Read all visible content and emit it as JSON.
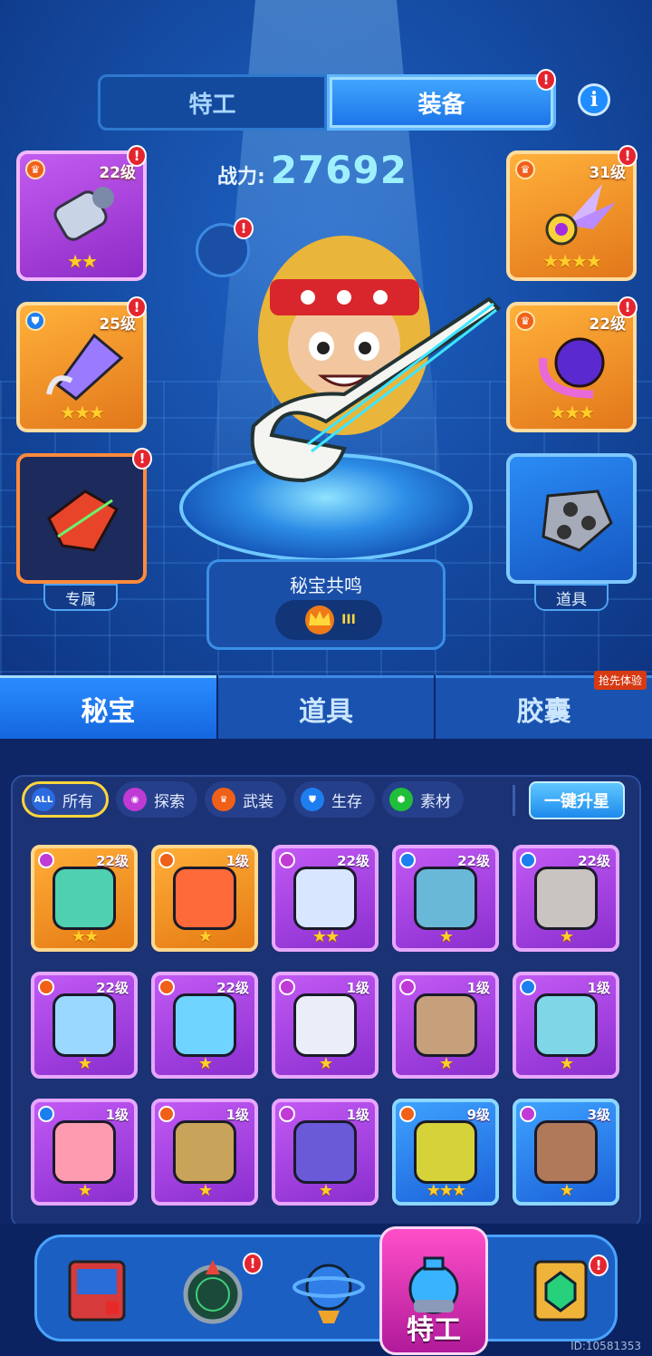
{
  "header": {
    "tabs": [
      {
        "label": "特工",
        "active": false
      },
      {
        "label": "装备",
        "active": true,
        "badge": "!"
      }
    ],
    "info_icon": "i"
  },
  "power": {
    "label": "战力:",
    "value": "27692"
  },
  "equipment": {
    "left": [
      {
        "level": "22级",
        "stars": "★★",
        "rarity": "purple",
        "badge": "!"
      },
      {
        "level": "25级",
        "stars": "★★★",
        "rarity": "orange",
        "badge": "!"
      },
      {
        "label": "专属",
        "rarity": "dark",
        "badge": "!"
      }
    ],
    "right": [
      {
        "level": "31级",
        "stars": "★★★★",
        "rarity": "orange",
        "badge": "!"
      },
      {
        "level": "22级",
        "stars": "★★★",
        "rarity": "orange",
        "badge": "!"
      },
      {
        "label": "道具",
        "rarity": "steel"
      }
    ]
  },
  "resonance": {
    "title": "秘宝共鸣",
    "rank": "III"
  },
  "tabs": [
    {
      "label": "秘宝",
      "active": true
    },
    {
      "label": "道具",
      "active": false
    },
    {
      "label": "胶囊",
      "active": false,
      "tag": "抢先体验"
    }
  ],
  "filters": [
    {
      "label": "所有",
      "icon": "ALL",
      "color": "#2a6be0",
      "selected": true
    },
    {
      "label": "探索",
      "icon": "◉",
      "color": "#c03ad6"
    },
    {
      "label": "武装",
      "icon": "♛",
      "color": "#f06018"
    },
    {
      "label": "生存",
      "icon": "⛊",
      "color": "#1d7ef0"
    },
    {
      "label": "素材",
      "icon": "⬢",
      "color": "#1fbf3a"
    }
  ],
  "upgrade_button": "一键升星",
  "items": [
    {
      "level": "22级",
      "stars": "★★",
      "rarity": "orange",
      "type_color": "#c03ad6"
    },
    {
      "level": "1级",
      "stars": "★",
      "rarity": "orange",
      "type_color": "#f06018"
    },
    {
      "level": "22级",
      "stars": "★★",
      "rarity": "purple",
      "type_color": "#c03ad6"
    },
    {
      "level": "22级",
      "stars": "★",
      "rarity": "purple",
      "type_color": "#1d7ef0"
    },
    {
      "level": "22级",
      "stars": "★",
      "rarity": "purple",
      "type_color": "#1d7ef0"
    },
    {
      "level": "22级",
      "stars": "★",
      "rarity": "purple",
      "type_color": "#f06018"
    },
    {
      "level": "22级",
      "stars": "★",
      "rarity": "purple",
      "type_color": "#f06018"
    },
    {
      "level": "1级",
      "stars": "★",
      "rarity": "purple",
      "type_color": "#c03ad6"
    },
    {
      "level": "1级",
      "stars": "★",
      "rarity": "purple",
      "type_color": "#c03ad6"
    },
    {
      "level": "1级",
      "stars": "★",
      "rarity": "purple",
      "type_color": "#1d7ef0"
    },
    {
      "level": "1级",
      "stars": "★",
      "rarity": "purple",
      "type_color": "#1d7ef0"
    },
    {
      "level": "1级",
      "stars": "★",
      "rarity": "purple",
      "type_color": "#f06018"
    },
    {
      "level": "1级",
      "stars": "★",
      "rarity": "purple",
      "type_color": "#c03ad6"
    },
    {
      "level": "9级",
      "stars": "★★★",
      "rarity": "blue",
      "type_color": "#f06018"
    },
    {
      "level": "3级",
      "stars": "★",
      "rarity": "blue",
      "type_color": "#c03ad6"
    }
  ],
  "nav": [
    {
      "icon": "arcade-icon"
    },
    {
      "icon": "radar-icon",
      "badge": "!"
    },
    {
      "icon": "planet-icon"
    },
    {
      "icon": "agent-helmet-icon",
      "label": "特工",
      "active": true
    },
    {
      "icon": "gem-frame-icon",
      "badge": "!"
    }
  ],
  "uid": "ID:10581353"
}
